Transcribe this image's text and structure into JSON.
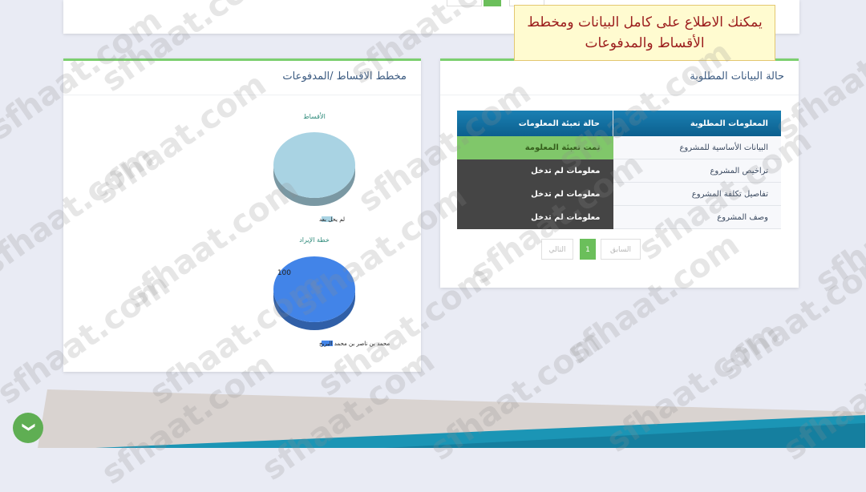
{
  "note": {
    "line1": "يمكنك الاطلاع على كامل البيانات ومخطط",
    "line2": "الأقساط والمدفوعات"
  },
  "required_data_panel": {
    "title": "حالة البيانات المطلوبة",
    "table": {
      "headers": [
        "المعلومات المطلوبة",
        "حالة تعبئة المعلومات"
      ],
      "rows": [
        {
          "item": "البيانات الأساسية للمشروع",
          "status": "تمت تعبئة المعلومة",
          "state": "filled"
        },
        {
          "item": "تراخيص المشروع",
          "status": "معلومات لم تدخل",
          "state": "missing"
        },
        {
          "item": "تفاصيل تكلفة المشروع",
          "status": "معلومات لم تدخل",
          "state": "missing"
        },
        {
          "item": "وصف المشروع",
          "status": "معلومات لم تدخل",
          "state": "missing"
        }
      ]
    },
    "pagination": {
      "prev_label": "السابق",
      "current_page": "1",
      "next_label": "التالي"
    }
  },
  "installments_panel": {
    "title": "مخطط الاقساط /المدفوعات",
    "chart_data": [
      {
        "type": "pie",
        "title": "الأقساط",
        "labels": [
          "لم يحل بعد"
        ],
        "values": [
          100
        ],
        "colors": [
          "#a9d3e3"
        ],
        "show_value_label": false
      },
      {
        "type": "pie",
        "title": "خطة الإيراد",
        "labels": [
          "محمد بن ناصر بن محمد البريخ"
        ],
        "values": [
          100
        ],
        "colors": [
          "#4284e8"
        ],
        "show_value_label": true
      }
    ]
  },
  "scroll_top": {
    "icon": "chevron-up-icon"
  },
  "watermark": {
    "text": "sfhaat.com"
  }
}
